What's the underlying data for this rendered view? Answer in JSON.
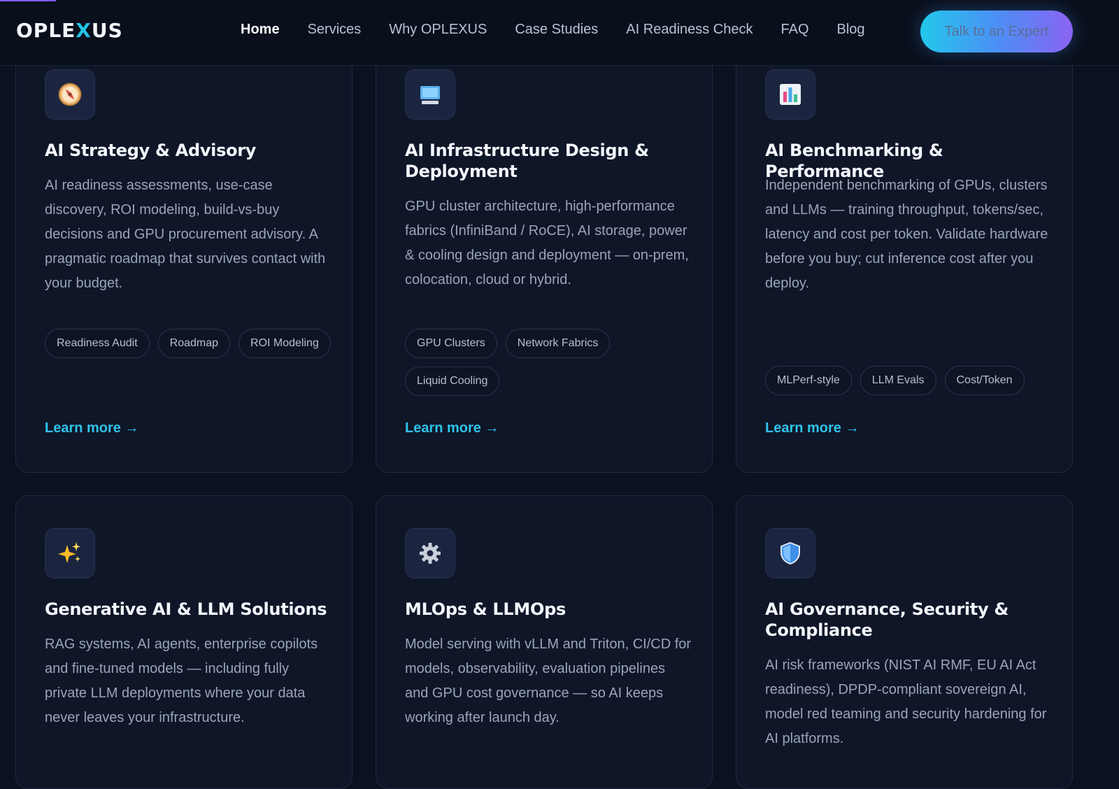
{
  "header": {
    "logo_pre": "OPLE",
    "logo_x": "X",
    "logo_post": "US",
    "nav": [
      "Home",
      "Services",
      "Why OPLEXUS",
      "Case Studies",
      "AI Readiness Check",
      "FAQ",
      "Blog"
    ],
    "active_nav": "Home",
    "cta": "Talk to an Expert"
  },
  "cards": [
    {
      "icon": "compass-icon",
      "title": "AI Strategy & Advisory",
      "description": "AI readiness assessments, use-case discovery, ROI modeling, build-vs-buy decisions and GPU procurement advisory. A pragmatic roadmap that survives contact with your budget.",
      "tags": [
        "Readiness Audit",
        "Roadmap",
        "ROI Modeling"
      ],
      "link": "Learn more →"
    },
    {
      "icon": "computer-icon",
      "title": "AI Infrastructure Design & Deployment",
      "description": "GPU cluster architecture, high-performance fabrics (InfiniBand / RoCE), AI storage, power & cooling design and deployment — on-prem, colocation, cloud or hybrid.",
      "tags": [
        "GPU Clusters",
        "Network Fabrics",
        "Liquid Cooling"
      ],
      "link": "Learn more →"
    },
    {
      "icon": "bar-chart-icon",
      "title": "AI Benchmarking & Performance",
      "description": "Independent benchmarking of GPUs, clusters and LLMs — training throughput, tokens/sec, latency and cost per token. Validate hardware before you buy; cut inference cost after you deploy.",
      "tags": [
        "MLPerf-style",
        "LLM Evals",
        "Cost/Token"
      ],
      "link": "Learn more →"
    },
    {
      "icon": "sparkles-icon",
      "title": "Generative AI & LLM Solutions",
      "description": "RAG systems, AI agents, enterprise copilots and fine-tuned models — including fully private LLM deployments where your data never leaves your infrastructure.",
      "tags": [],
      "link": ""
    },
    {
      "icon": "gear-icon",
      "title": "MLOps & LLMOps",
      "description": "Model serving with vLLM and Triton, CI/CD for models, observability, evaluation pipelines and GPU cost governance — so AI keeps working after launch day.",
      "tags": [],
      "link": ""
    },
    {
      "icon": "shield-icon",
      "title": "AI Governance, Security & Compliance",
      "description": "AI risk frameworks (NIST AI RMF, EU AI Act readiness), DPDP-compliant sovereign AI, model red teaming and security hardening for AI platforms.",
      "tags": [],
      "link": ""
    }
  ]
}
